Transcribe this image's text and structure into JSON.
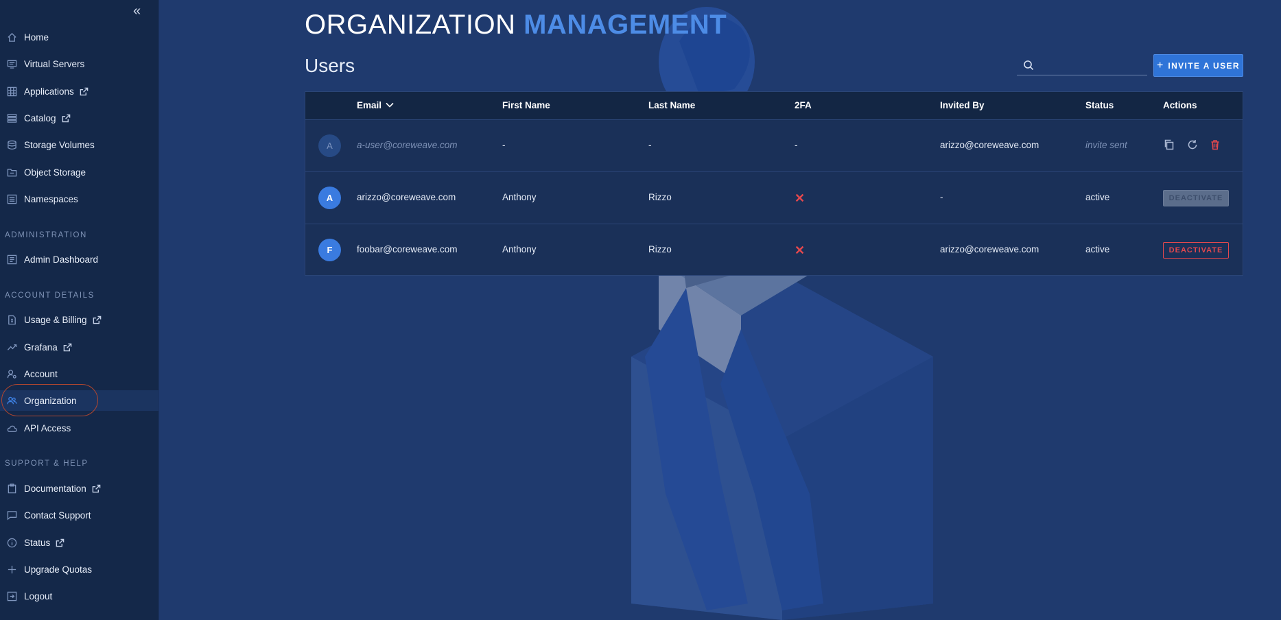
{
  "sidebar": {
    "collapse_icon": "double-chevron-left-icon",
    "items": [
      {
        "label": "Home",
        "icon": "home-icon",
        "external": false
      },
      {
        "label": "Virtual Servers",
        "icon": "monitor-icon",
        "external": false
      },
      {
        "label": "Applications",
        "icon": "grid-icon",
        "external": true
      },
      {
        "label": "Catalog",
        "icon": "list-icon",
        "external": true
      },
      {
        "label": "Storage Volumes",
        "icon": "database-icon",
        "external": false
      },
      {
        "label": "Object Storage",
        "icon": "folder-icon",
        "external": false
      },
      {
        "label": "Namespaces",
        "icon": "namespace-icon",
        "external": false
      }
    ],
    "admin_title": "ADMINISTRATION",
    "admin_items": [
      {
        "label": "Admin Dashboard",
        "icon": "dashboard-icon",
        "external": false
      }
    ],
    "account_title": "ACCOUNT DETAILS",
    "account_items": [
      {
        "label": "Usage & Billing",
        "icon": "billing-icon",
        "external": true
      },
      {
        "label": "Grafana",
        "icon": "trend-icon",
        "external": true
      },
      {
        "label": "Account",
        "icon": "user-gear-icon",
        "external": false
      },
      {
        "label": "Organization",
        "icon": "users-icon",
        "external": false,
        "active": true
      },
      {
        "label": "API Access",
        "icon": "cloud-icon",
        "external": false
      }
    ],
    "support_title": "SUPPORT & HELP",
    "support_items": [
      {
        "label": "Documentation",
        "icon": "clipboard-icon",
        "external": true
      },
      {
        "label": "Contact Support",
        "icon": "chat-icon",
        "external": false
      },
      {
        "label": "Status",
        "icon": "info-icon",
        "external": true
      },
      {
        "label": "Upgrade Quotas",
        "icon": "plus-icon",
        "external": false
      },
      {
        "label": "Logout",
        "icon": "logout-icon",
        "external": false
      }
    ]
  },
  "header": {
    "title_light": "ORGANIZATION",
    "title_bold": "MANAGEMENT",
    "subtitle": "Users"
  },
  "search": {
    "placeholder": "",
    "value": ""
  },
  "invite_button": {
    "plus": "+",
    "label": "INVITE A USER"
  },
  "table": {
    "columns": [
      "Email",
      "First Name",
      "Last Name",
      "2FA",
      "Invited By",
      "Status",
      "Actions"
    ],
    "sort_column": "Email",
    "rows": [
      {
        "avatar": "A",
        "email": "a-user@coreweave.com",
        "first_name": "-",
        "last_name": "-",
        "twofa": "-",
        "invited_by": "arizzo@coreweave.com",
        "status": "invite sent",
        "pending": true
      },
      {
        "avatar": "A",
        "email": "arizzo@coreweave.com",
        "first_name": "Anthony",
        "last_name": "Rizzo",
        "twofa": "✕",
        "invited_by": "-",
        "status": "active",
        "action": "DEACTIVATE",
        "action_enabled": false
      },
      {
        "avatar": "F",
        "email": "foobar@coreweave.com",
        "first_name": "Anthony",
        "last_name": "Rizzo",
        "twofa": "✕",
        "invited_by": "arizzo@coreweave.com",
        "status": "active",
        "action": "DEACTIVATE",
        "action_enabled": true
      }
    ]
  },
  "colors": {
    "accent": "#2f74d8",
    "danger": "#e5484d",
    "background": "#1f3a6e",
    "sidebar": "#142849"
  }
}
